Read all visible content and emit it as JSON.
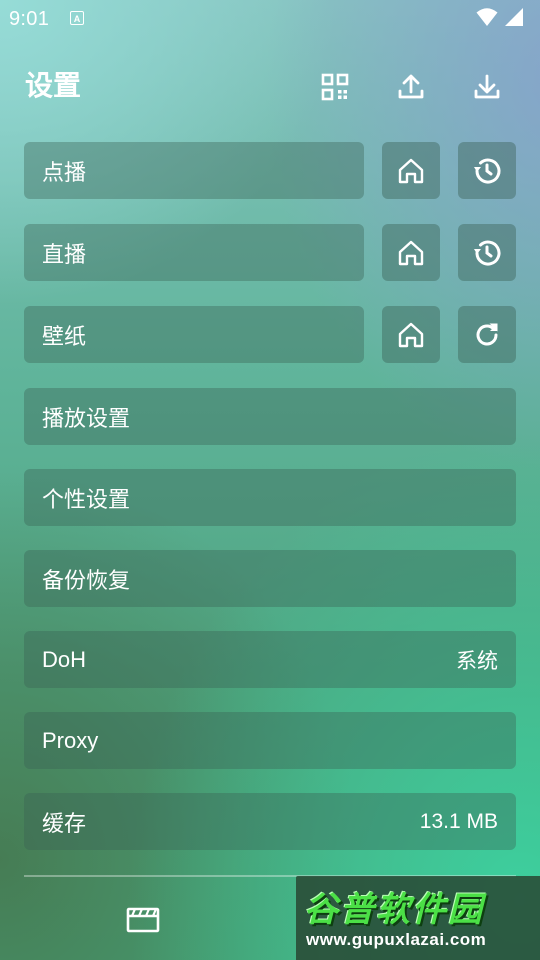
{
  "status_bar": {
    "time": "9:01",
    "notification_letter": "A"
  },
  "header": {
    "title": "设置"
  },
  "rows": {
    "vod": {
      "label": "点播"
    },
    "live": {
      "label": "直播"
    },
    "wallpaper": {
      "label": "壁纸"
    },
    "playback": {
      "label": "播放设置"
    },
    "personalize": {
      "label": "个性设置"
    },
    "backup": {
      "label": "备份恢复"
    },
    "doh": {
      "label": "DoH",
      "value": "系统"
    },
    "proxy": {
      "label": "Proxy"
    },
    "cache": {
      "label": "缓存",
      "value": "13.1 MB"
    }
  },
  "watermark": {
    "brand": "谷普软件园",
    "url": "www.gupuxlazai.com"
  }
}
